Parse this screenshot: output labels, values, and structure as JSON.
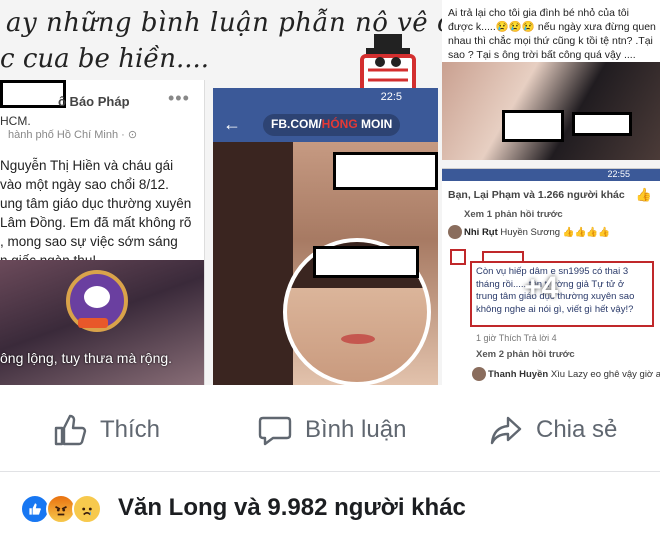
{
  "collage": {
    "handwritten": {
      "line1": "ay những bình luận phẫn nô vê cai chê",
      "line2": "c cua be hiền...."
    },
    "left_post": {
      "page_name": "ô Báo Pháp",
      "line_a": "HCM.",
      "line_b": "hành phố Hồ Chí Minh · ⊙",
      "body": "Nguyễn Thị Hiền và cháu gái\nvào một ngày sao chổi 8/12.\nung tâm giáo dục thường xuyên\nLâm Đồng. Em đã mất không rõ\n, mong sao sự việc sớm sáng\nn giấc ngàn thu!",
      "video_caption": "ông lộng, tuy thưa mà rộng."
    },
    "mid_post": {
      "status_time": "22:5",
      "url_prefix": "FB.COM/",
      "url_highlight": "HÓNG",
      "url_suffix": " MOIN"
    },
    "right_top_post": {
      "text": "Ai trả lại cho tôi gia đình bé nhỏ của tôi được k.....😢😢😢 nếu ngày xưa đừng quen nhau thì chắc mọi thứ cũng k tồi tệ ntn? .Tại sao ? Tại s ông trời bất công quá vậy ...."
    },
    "right_bottom_post": {
      "status_time": "22:55",
      "reactions_line": "Bạn, Lại Phạm và 1.266 người khác",
      "prev_replies_1": "Xem 1 phản hồi trước",
      "comment1_author": "Nhi Rụt",
      "comment1_text": "Huyền Sương 👍👍👍👍",
      "boxed_comment": "Còn vụ hiếp dâm e sn1995 có thai 3 tháng rồi..... tôn trường giả Tự tử ở trung tâm giáo dục thường xuyên sao không nghe ai nói gì, viết gì hết vậy!?",
      "plus_count": "+4",
      "meta": "1 giờ   Thích   Trả lời   4",
      "prev_replies_2": "Xem 2 phản hồi trước",
      "comment2_author": "Thanh Huyền",
      "comment2_text": "Xìu Lazy eo ghê vậy giờ ai..."
    }
  },
  "actions": {
    "like_label": "Thích",
    "comment_label": "Bình luận",
    "share_label": "Chia sẻ"
  },
  "summary": {
    "names": "Văn Long và 9.982 người khác",
    "reaction_icons": [
      "like-icon",
      "angry-icon",
      "sad-icon"
    ]
  },
  "colors": {
    "facebook_blue": "#3b5998",
    "like_blue": "#1877f2",
    "action_gray": "#606770",
    "highlight_red": "#c0282a"
  }
}
